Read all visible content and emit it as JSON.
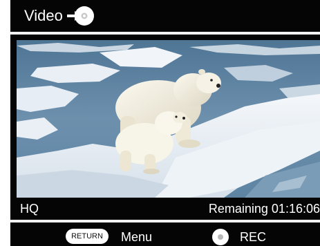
{
  "header": {
    "title": "Video",
    "arrow_icon": "arrow-right-icon",
    "disc_icon": "disc-icon"
  },
  "video": {
    "content": "polar-bears-on-ice"
  },
  "info_bar": {
    "quality": "HQ",
    "remaining": "Remaining 01:16:06"
  },
  "footer": {
    "return_label": "RETURN",
    "menu_label": "Menu",
    "rec_label": "REC"
  },
  "colors": {
    "background": "#050505",
    "text": "#ffffff",
    "divider": "#f2f2f2",
    "button_fill": "#ffffff"
  }
}
